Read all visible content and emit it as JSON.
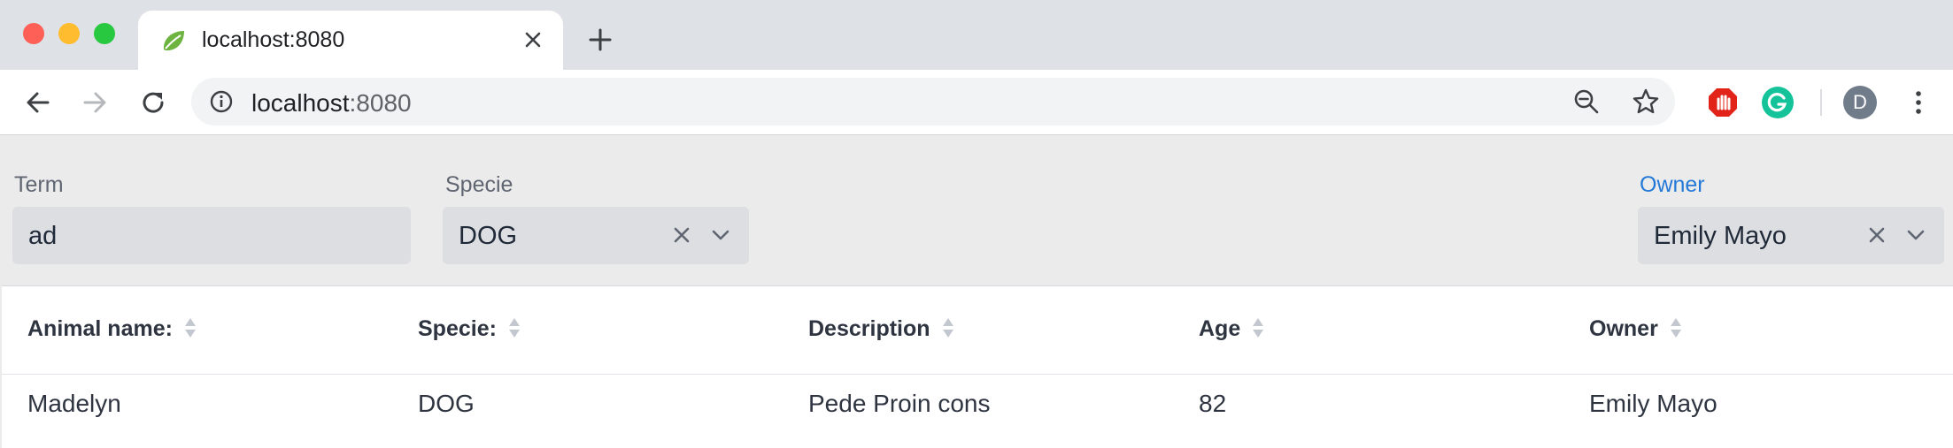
{
  "browser": {
    "tab": {
      "title": "localhost:8080",
      "favicon": "spring-leaf-icon"
    },
    "address": {
      "host": "localhost",
      "port": ":8080"
    },
    "profile_initial": "D",
    "colors": {
      "tabstrip": "#dee1e6",
      "grammarly": "#15c39a",
      "adblock": "#e2231a"
    }
  },
  "filters": {
    "term": {
      "label": "Term",
      "value": "ad"
    },
    "specie": {
      "label": "Specie",
      "value": "DOG"
    },
    "owner": {
      "label": "Owner",
      "value": "Emily Mayo",
      "label_color": "#2479d8"
    }
  },
  "table": {
    "columns": [
      "Animal name:",
      "Specie:",
      "Description",
      "Age",
      "Owner"
    ],
    "rows": [
      [
        "Madelyn",
        "DOG",
        "Pede Proin cons",
        "82",
        "Emily Mayo"
      ]
    ]
  }
}
